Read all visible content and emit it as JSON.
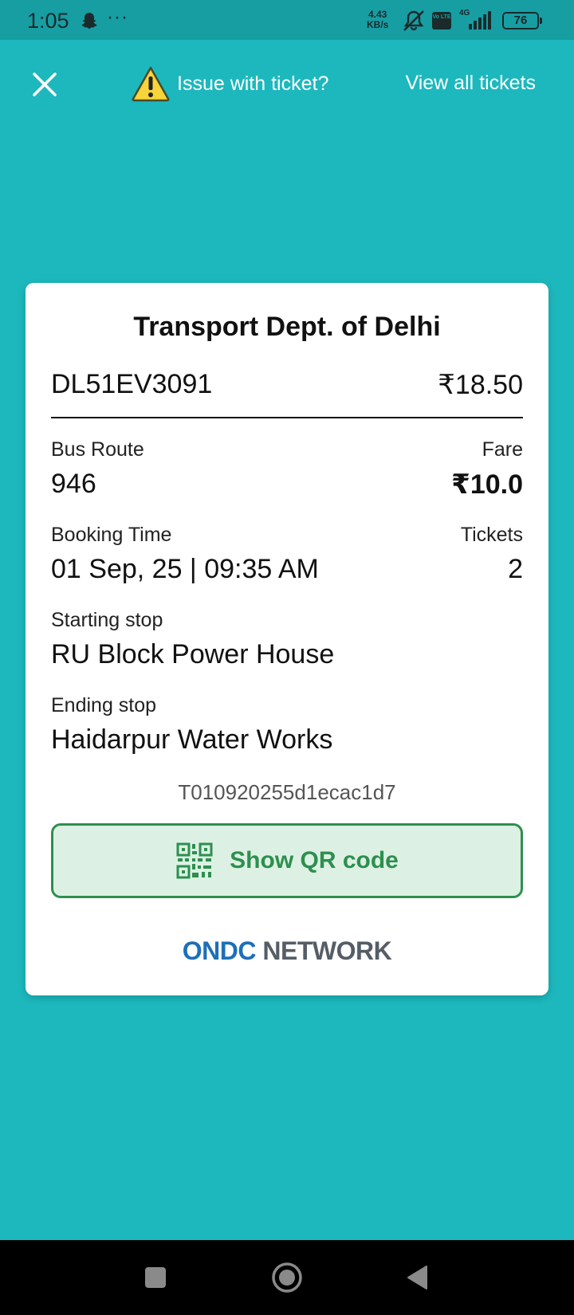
{
  "status_bar": {
    "time": "1:05",
    "more": "···",
    "speed_value": "4.43",
    "speed_unit": "KB/s",
    "network": "4G",
    "volte": "Vo LTE",
    "battery": "76"
  },
  "header": {
    "issue_label": "Issue with ticket?",
    "view_all_label": "View all tickets"
  },
  "ticket": {
    "operator": "Transport Dept. of Delhi",
    "vehicle_number": "DL51EV3091",
    "total_amount": "₹18.50",
    "route_label": "Bus Route",
    "route_value": "946",
    "fare_label": "Fare",
    "fare_value": "₹10.0",
    "booking_label": "Booking Time",
    "booking_value": "01 Sep, 25 | 09:35 AM",
    "tickets_label": "Tickets",
    "tickets_value": "2",
    "start_label": "Starting stop",
    "start_value": "RU Block Power House",
    "end_label": "Ending stop",
    "end_value": "Haidarpur Water Works",
    "ticket_id": "T010920255d1ecac1d7",
    "qr_button_label": "Show QR code",
    "network_brand": "ONDC",
    "network_word": "NETWORK"
  },
  "icons": {
    "close": "close-icon",
    "warning": "warning-icon",
    "qr": "qr-code-icon",
    "nav_recent": "recents-icon",
    "nav_home": "home-icon",
    "nav_back": "back-icon"
  },
  "colors": {
    "background": "#1cb8bd",
    "status_bar": "#169ea3",
    "card": "#ffffff",
    "qr_button_fill": "#dcf1e4",
    "qr_button_accent": "#2e8f4e",
    "ondc_blue": "#1d6fb8"
  }
}
